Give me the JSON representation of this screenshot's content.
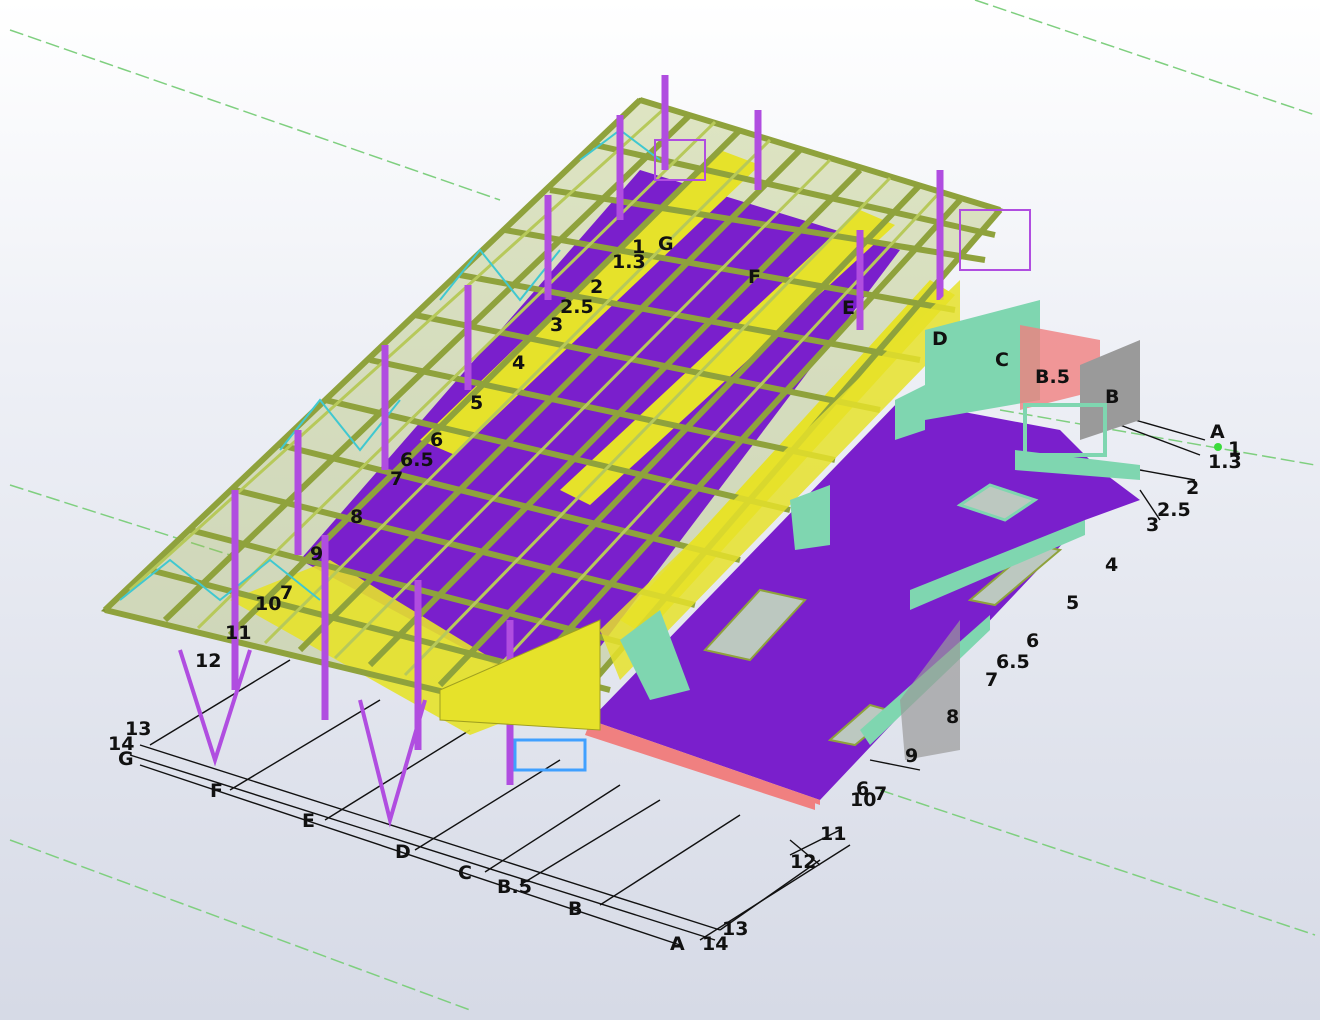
{
  "viewport": {
    "background_top": "#ffffff",
    "background_bottom": "#d6dae6",
    "colors": {
      "floor": "#7a1fcc",
      "column": "#b04de0",
      "beam": "#8fa23c",
      "beam_light": "#b7c95a",
      "girder": "#e6e22a",
      "wall": "#7fd6b0",
      "rail": "#f08080",
      "bracing": "#40c8d0",
      "guide_line": "#7fcf7f"
    }
  },
  "grid": {
    "bottom_letters": [
      "G",
      "F",
      "E",
      "D",
      "C",
      "B.5",
      "B",
      "A"
    ],
    "bottom_left_numbers": [
      "13",
      "14"
    ],
    "bottom_right_numbers": [
      "11",
      "12",
      "13",
      "14"
    ],
    "bottom_right_near_10": [
      "6",
      "7",
      "10"
    ],
    "right_letters": [
      "A",
      "B",
      "B.5",
      "C",
      "D",
      "E",
      "F",
      "G"
    ],
    "right_numbers": [
      "1",
      "1.3",
      "2",
      "2.5",
      "3",
      "4",
      "5",
      "6",
      "6.5",
      "7",
      "8",
      "9"
    ],
    "left_numbers": [
      "9",
      "7",
      "10",
      "11",
      "12"
    ],
    "top_numbers": [
      "1",
      "1.3",
      "2",
      "2.5",
      "3",
      "4",
      "5",
      "6",
      "6.5",
      "7",
      "8"
    ]
  }
}
